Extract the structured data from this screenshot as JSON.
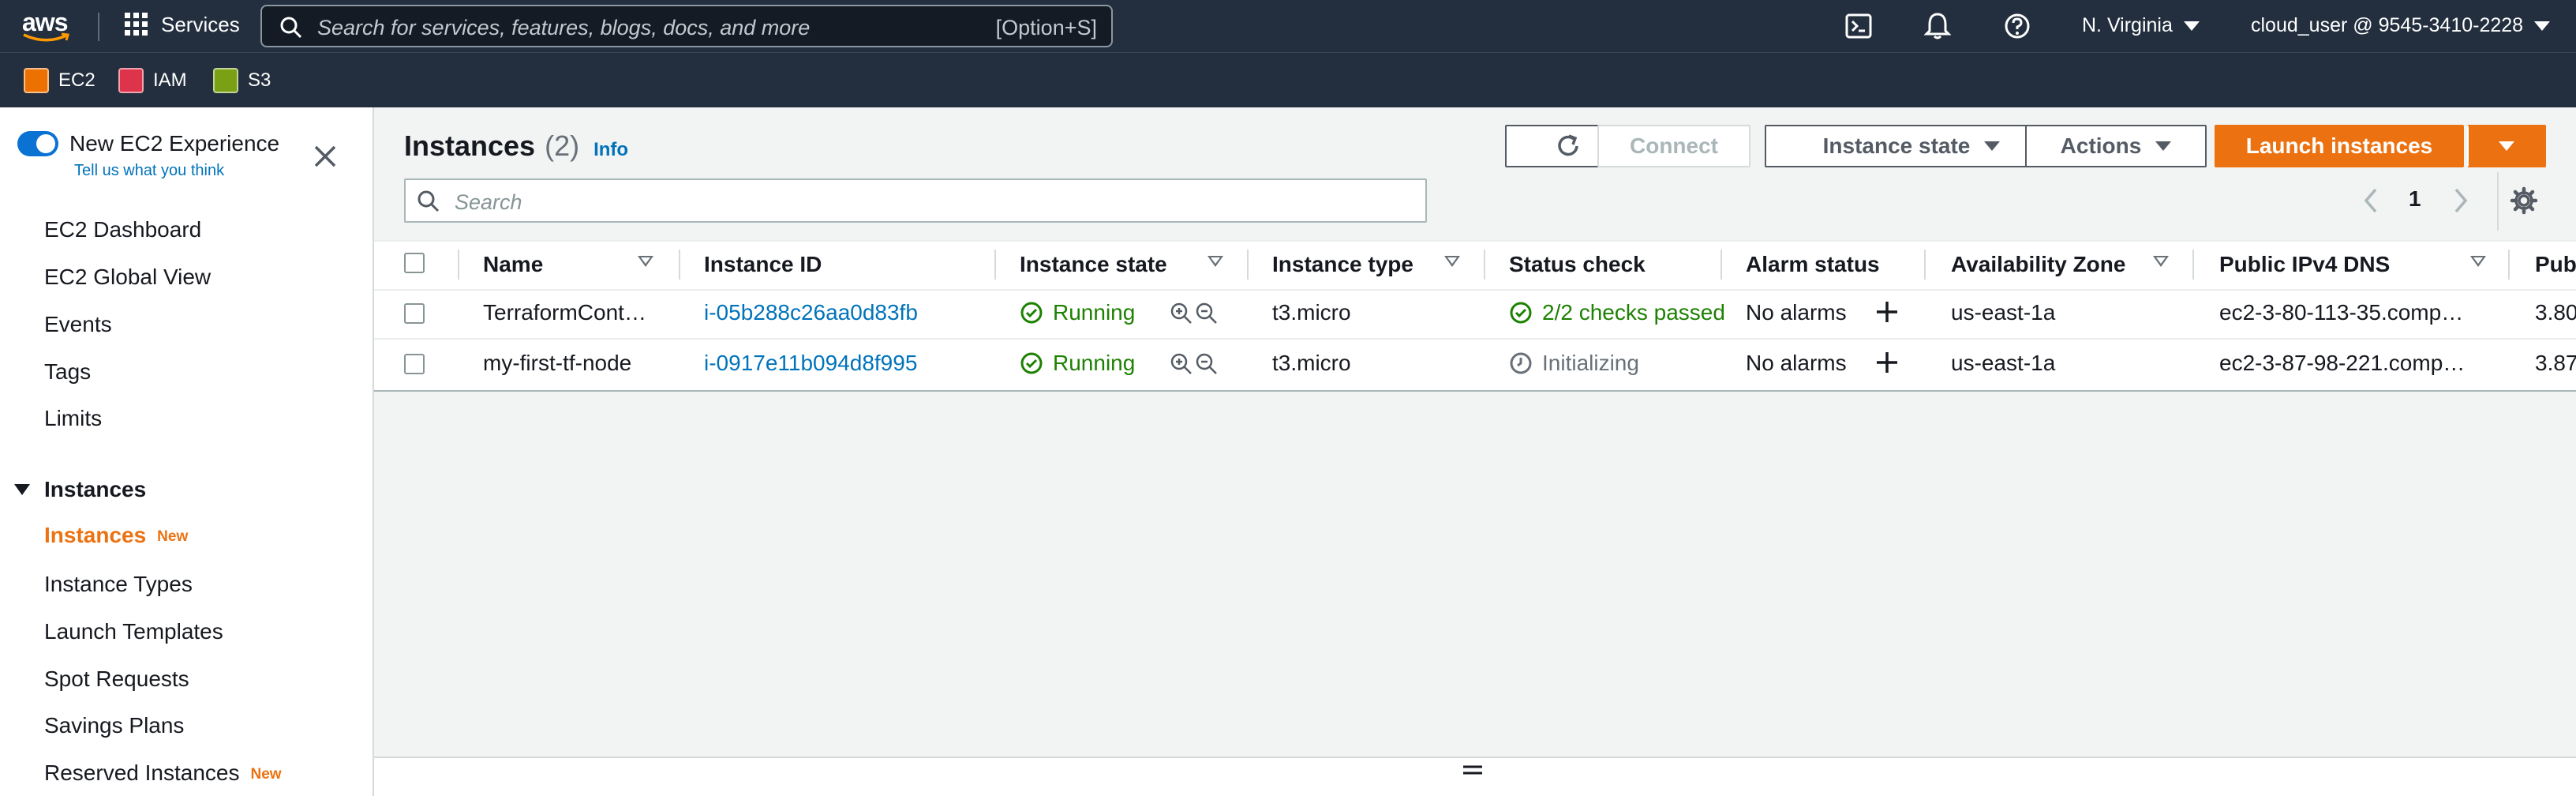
{
  "topnav": {
    "logo": "aws",
    "services_label": "Services",
    "search_placeholder": "Search for services, features, blogs, docs, and more",
    "search_shortcut": "[Option+S]",
    "region": "N. Virginia",
    "account": "cloud_user @ 9545-3410-2228",
    "icons": [
      "grid-icon",
      "search-icon",
      "cloudshell-icon",
      "bell-icon",
      "help-icon"
    ]
  },
  "favorites": [
    {
      "label": "EC2",
      "color": "#ed7100"
    },
    {
      "label": "IAM",
      "color": "#dd344c"
    },
    {
      "label": "S3",
      "color": "#7aa116"
    }
  ],
  "sidebar": {
    "toggle_label": "New EC2 Experience",
    "feedback_link": "Tell us what you think",
    "items": [
      "EC2 Dashboard",
      "EC2 Global View",
      "Events",
      "Tags",
      "Limits"
    ],
    "section_title": "Instances",
    "section_items": [
      {
        "label": "Instances",
        "badge": "New",
        "active": true
      },
      {
        "label": "Instance Types",
        "badge": ""
      },
      {
        "label": "Launch Templates",
        "badge": ""
      },
      {
        "label": "Spot Requests",
        "badge": ""
      },
      {
        "label": "Savings Plans",
        "badge": ""
      },
      {
        "label": "Reserved Instances",
        "badge": "New"
      }
    ]
  },
  "main": {
    "title": "Instances",
    "count": "(2)",
    "info": "Info",
    "buttons": {
      "connect": "Connect",
      "instance_state": "Instance state",
      "actions": "Actions",
      "launch": "Launch instances"
    },
    "filter_placeholder": "Search",
    "page": "1",
    "columns": [
      "Name",
      "Instance ID",
      "Instance state",
      "Instance type",
      "Status check",
      "Alarm status",
      "Availability Zone",
      "Public IPv4 DNS",
      "Pub"
    ],
    "rows": [
      {
        "name": "TerraformCont…",
        "id": "i-05b288c26aa0d83fb",
        "state": "Running",
        "type": "t3.micro",
        "status": "2/2 checks passed",
        "alarm": "No alarms",
        "az": "us-east-1a",
        "dns": "ec2-3-80-113-35.comp…",
        "ip": "3.80"
      },
      {
        "name": "my-first-tf-node",
        "id": "i-0917e11b094d8f995",
        "state": "Running",
        "type": "t3.micro",
        "status": "Initializing",
        "alarm": "No alarms",
        "az": "us-east-1a",
        "dns": "ec2-3-87-98-221.comp…",
        "ip": "3.87"
      }
    ]
  },
  "colors": {
    "nav_bg": "#232f3e",
    "accent": "#ec7211",
    "link": "#0073bb",
    "success": "#1d8102"
  }
}
